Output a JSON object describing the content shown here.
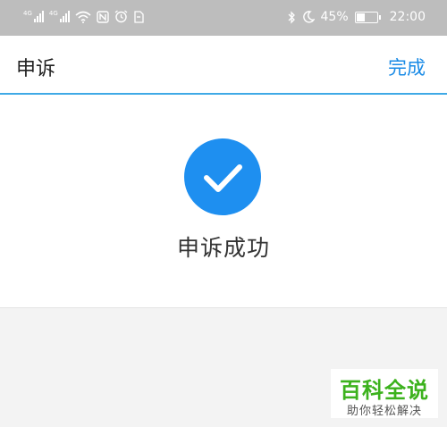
{
  "status_bar": {
    "network_left": "4G",
    "network_right": "4G",
    "battery_percent": "45%",
    "battery_level": 0.45,
    "time": "22:00",
    "icons_left": [
      "signal-icon",
      "signal-icon",
      "wifi-icon",
      "nfc-icon",
      "alarm-icon",
      "sim-icon"
    ],
    "icons_right": [
      "bluetooth-icon",
      "moon-icon",
      "battery-icon"
    ]
  },
  "nav": {
    "title": "申诉",
    "done_label": "完成",
    "underline_color": "#3fa9e6"
  },
  "main": {
    "success_icon": "check-circle-icon",
    "success_color": "#1e8ff0",
    "message": "申诉成功"
  },
  "watermark": {
    "title": "百科全说",
    "subtitle": "助你轻松解决",
    "color": "#3cb21d"
  }
}
